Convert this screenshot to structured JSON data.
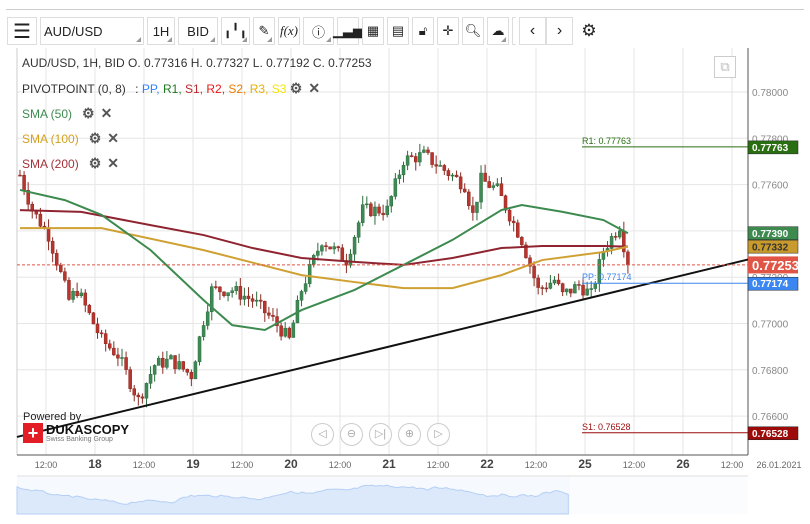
{
  "toolbar": {
    "menu_icon": "menu-icon",
    "symbol": "AUD/USD",
    "timeframe": "1H",
    "side": "BID",
    "buttons": [
      "candle-type",
      "draw",
      "f(x)",
      "info",
      "volume",
      "calendar",
      "news",
      "lock",
      "crosshair",
      "zoom",
      "upload",
      "prev",
      "next",
      "settings"
    ],
    "fx_label": "f(x)"
  },
  "legend": {
    "ohlc": "AUD/USD, 1H, BID   O. 0.77316 H. 0.77327 L. 0.77192 C. 0.77253",
    "pivot_label": "PIVOTPOINT (0, 8)",
    "pivot_sep": ":",
    "pivot_items": [
      {
        "t": "PP,",
        "c": "#2f7fff"
      },
      {
        "t": "R1,",
        "c": "#1f7a1f"
      },
      {
        "t": "S1,",
        "c": "#c0282d"
      },
      {
        "t": "R2,",
        "c": "#e81b1b"
      },
      {
        "t": "S2,",
        "c": "#f07b00"
      },
      {
        "t": "R3,",
        "c": "#e8b000"
      },
      {
        "t": "S3",
        "c": "#f5e400"
      }
    ],
    "sma": [
      {
        "label": "SMA (50)",
        "color": "#3d8a4f"
      },
      {
        "label": "SMA (100)",
        "color": "#d4a020"
      },
      {
        "label": "SMA (200)",
        "color": "#a33238"
      }
    ]
  },
  "branding": {
    "powered": "Powered by",
    "name": "DUKASCOPY",
    "sub": "Swiss Banking Group"
  },
  "chart_data": {
    "type": "candlestick",
    "ylim": [
      0.764,
      0.7825
    ],
    "yticks": [
      "0.78000",
      "0.77800",
      "0.77600",
      "0.77400",
      "0.77200",
      "0.77000",
      "0.76800",
      "0.76600"
    ],
    "xticks": [
      {
        "l": "12:00",
        "b": false
      },
      {
        "l": "18",
        "b": true
      },
      {
        "l": "12:00",
        "b": false
      },
      {
        "l": "19",
        "b": true
      },
      {
        "l": "12:00",
        "b": false
      },
      {
        "l": "20",
        "b": true
      },
      {
        "l": "12:00",
        "b": false
      },
      {
        "l": "21",
        "b": true
      },
      {
        "l": "12:00",
        "b": false
      },
      {
        "l": "22",
        "b": true
      },
      {
        "l": "12:00",
        "b": false
      },
      {
        "l": "25",
        "b": true
      },
      {
        "l": "12:00",
        "b": false
      },
      {
        "l": "26",
        "b": true
      },
      {
        "l": "12:00",
        "b": false
      }
    ],
    "date_label": "26.01.2021",
    "price_path": [
      [
        0,
        0.77641
      ],
      [
        3,
        0.7749
      ],
      [
        7,
        0.77382
      ],
      [
        12,
        0.77101
      ],
      [
        14,
        0.77145
      ],
      [
        20,
        0.76929
      ],
      [
        24,
        0.76864
      ],
      [
        29,
        0.76669
      ],
      [
        33,
        0.76821
      ],
      [
        37,
        0.76842
      ],
      [
        42,
        0.76777
      ],
      [
        45,
        0.77015
      ],
      [
        47,
        0.77145
      ],
      [
        52,
        0.77145
      ],
      [
        57,
        0.77101
      ],
      [
        62,
        0.77015
      ],
      [
        66,
        0.76929
      ],
      [
        69,
        0.77145
      ],
      [
        74,
        0.77361
      ],
      [
        80,
        0.77274
      ],
      [
        84,
        0.7749
      ],
      [
        90,
        0.7749
      ],
      [
        94,
        0.77706
      ],
      [
        99,
        0.77728
      ],
      [
        104,
        0.77663
      ],
      [
        109,
        0.77598
      ],
      [
        111,
        0.77469
      ],
      [
        113,
        0.7762
      ],
      [
        117,
        0.77577
      ],
      [
        120,
        0.77469
      ],
      [
        123,
        0.77361
      ],
      [
        127,
        0.77145
      ],
      [
        131,
        0.77188
      ],
      [
        133,
        0.77123
      ],
      [
        137,
        0.77166
      ],
      [
        140,
        0.77123
      ],
      [
        143,
        0.77317
      ],
      [
        147,
        0.77425
      ],
      [
        149,
        0.77253
      ]
    ],
    "sma50": [
      [
        0,
        0.77577
      ],
      [
        11,
        0.77533
      ],
      [
        20,
        0.77469
      ],
      [
        32,
        0.77317
      ],
      [
        45,
        0.77101
      ],
      [
        52,
        0.76993
      ],
      [
        60,
        0.76972
      ],
      [
        69,
        0.77058
      ],
      [
        82,
        0.77145
      ],
      [
        94,
        0.77253
      ],
      [
        106,
        0.77361
      ],
      [
        118,
        0.7749
      ],
      [
        123,
        0.77512
      ],
      [
        133,
        0.77482
      ],
      [
        143,
        0.77447
      ],
      [
        149,
        0.7739
      ]
    ],
    "sma100": [
      [
        0,
        0.77412
      ],
      [
        20,
        0.77412
      ],
      [
        45,
        0.77317
      ],
      [
        69,
        0.77209
      ],
      [
        82,
        0.77179
      ],
      [
        94,
        0.77153
      ],
      [
        106,
        0.77153
      ],
      [
        118,
        0.77209
      ],
      [
        128,
        0.77274
      ],
      [
        143,
        0.77309
      ],
      [
        149,
        0.77332
      ]
    ],
    "sma200": [
      [
        0,
        0.7749
      ],
      [
        15,
        0.77482
      ],
      [
        32,
        0.77425
      ],
      [
        45,
        0.77382
      ],
      [
        57,
        0.77326
      ],
      [
        69,
        0.77283
      ],
      [
        82,
        0.77266
      ],
      [
        94,
        0.77253
      ],
      [
        106,
        0.77283
      ],
      [
        118,
        0.77326
      ],
      [
        128,
        0.77335
      ],
      [
        143,
        0.77335
      ],
      [
        149,
        0.77332
      ]
    ],
    "trendline": [
      [
        0,
        0.7651
      ],
      [
        179,
        0.77279
      ]
    ],
    "pivots": [
      {
        "label": "R1: 0.77763",
        "value": 0.77763,
        "tag": "0.77763",
        "color": "#2a6e12"
      },
      {
        "label": "PP: 0.77174",
        "value": 0.77174,
        "tag": "0.77174",
        "color": "#3b86f0"
      },
      {
        "label": "S1: 0.76528",
        "value": 0.76528,
        "tag": "0.76528",
        "color": "#9c0a0a"
      }
    ],
    "tags": [
      {
        "value": 0.7739,
        "tag": "0.77390",
        "color": "#3d8a4f"
      },
      {
        "value": 0.77332,
        "tag": "0.77332",
        "color": "#c99b2c"
      },
      {
        "value": 0.77253,
        "tag": "0.77253",
        "color": "#e05545"
      }
    ],
    "last_price": 0.77253
  }
}
